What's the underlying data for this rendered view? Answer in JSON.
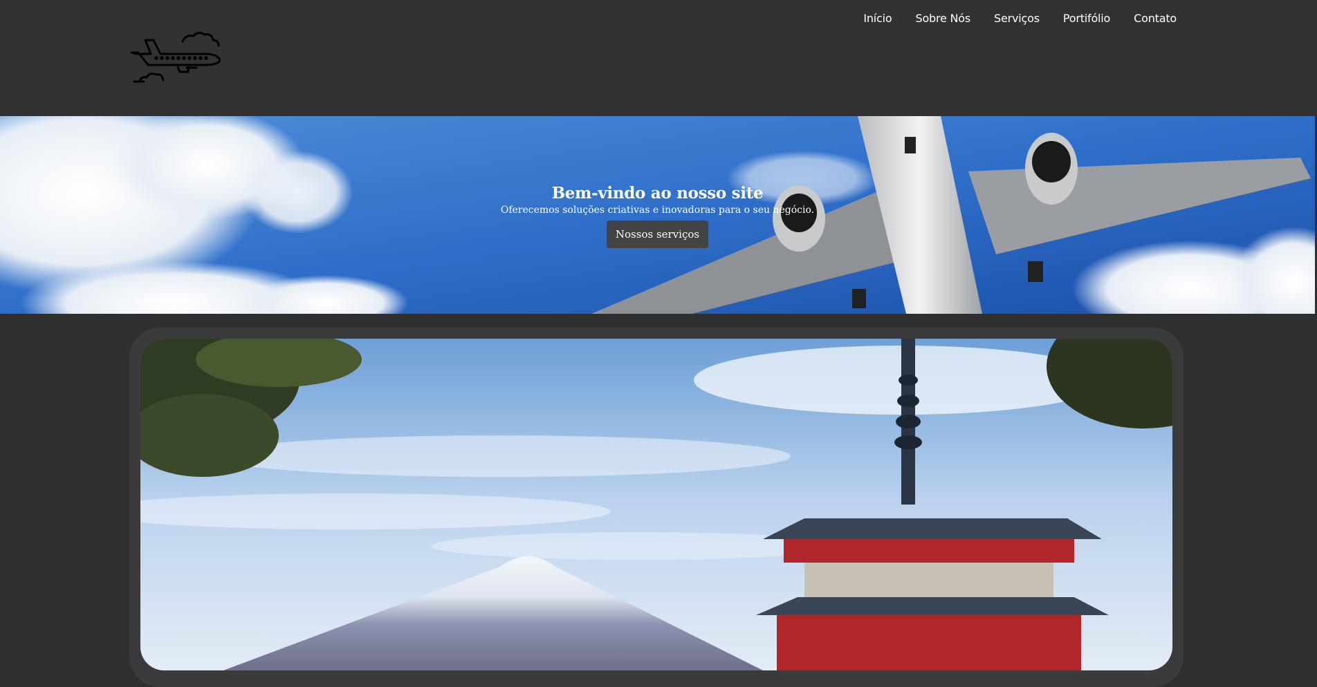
{
  "header": {
    "logo_icon": "airplane-clouds-icon",
    "nav": [
      {
        "label": "Início"
      },
      {
        "label": "Sobre Nós"
      },
      {
        "label": "Serviços"
      },
      {
        "label": "Portifólio"
      },
      {
        "label": "Contato"
      }
    ]
  },
  "hero": {
    "title": "Bem-vindo ao nosso site",
    "subtitle": "Oferecemos soluções criativas e inovadoras para o seu negócio.",
    "button_label": "Nossos serviços",
    "image": "airplane-sky-photo"
  },
  "showcase": {
    "image": "mount-fuji-pagoda-photo"
  },
  "colors": {
    "background": "#2f2f2f",
    "header": "#323232",
    "button": "#444343",
    "frame": "#3b3b3b"
  }
}
